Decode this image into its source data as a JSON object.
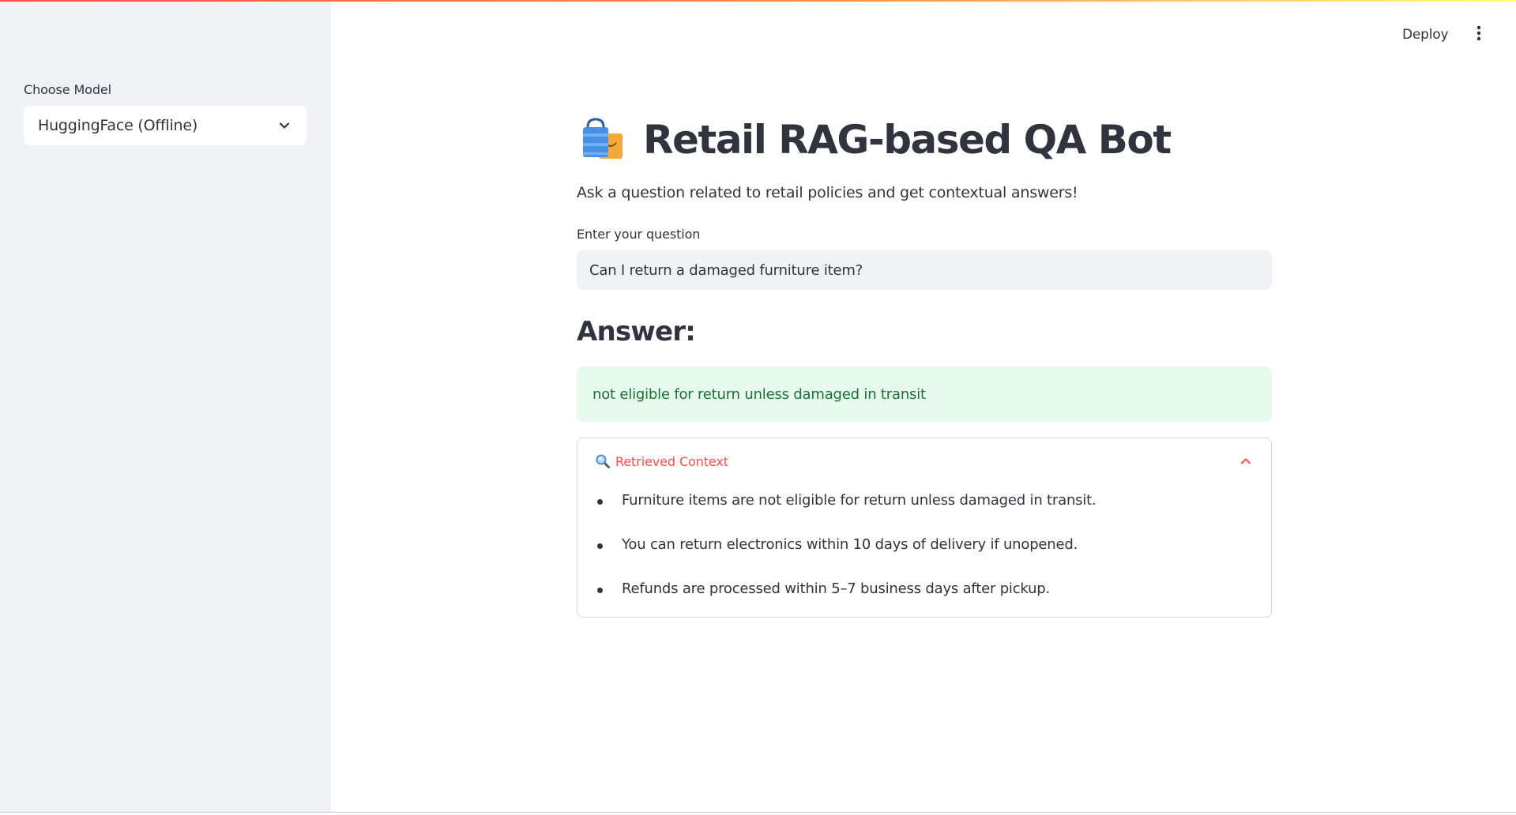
{
  "sidebar": {
    "model_label": "Choose Model",
    "model_value": "HuggingFace (Offline)",
    "model_icon": "chevron-down-icon"
  },
  "header": {
    "deploy_label": "Deploy",
    "menu_icon": "more-vertical-icon"
  },
  "main": {
    "title_icon": "shopping-bags-icon",
    "title": "Retail RAG-based QA Bot",
    "subtitle": "Ask a question related to retail policies and get contextual answers!",
    "question_label": "Enter your question",
    "question_value": "Can I return a damaged furniture item?",
    "answer_heading": "Answer:",
    "answer_text": "not eligible for return unless damaged in transit",
    "context": {
      "icon": "magnifier-icon",
      "title": "Retrieved Context",
      "expanded": true,
      "items": [
        "Furniture items are not eligible for return unless damaged in transit.",
        "You can return electronics within 10 days of delivery if unopened.",
        "Refunds are processed within 5–7 business days after pickup."
      ]
    }
  },
  "colors": {
    "sidebar_bg": "#f0f2f6",
    "text": "#31333f",
    "accent": "#ff4b4b",
    "success_bg": "#e8f9ee",
    "success_text": "#177233"
  }
}
